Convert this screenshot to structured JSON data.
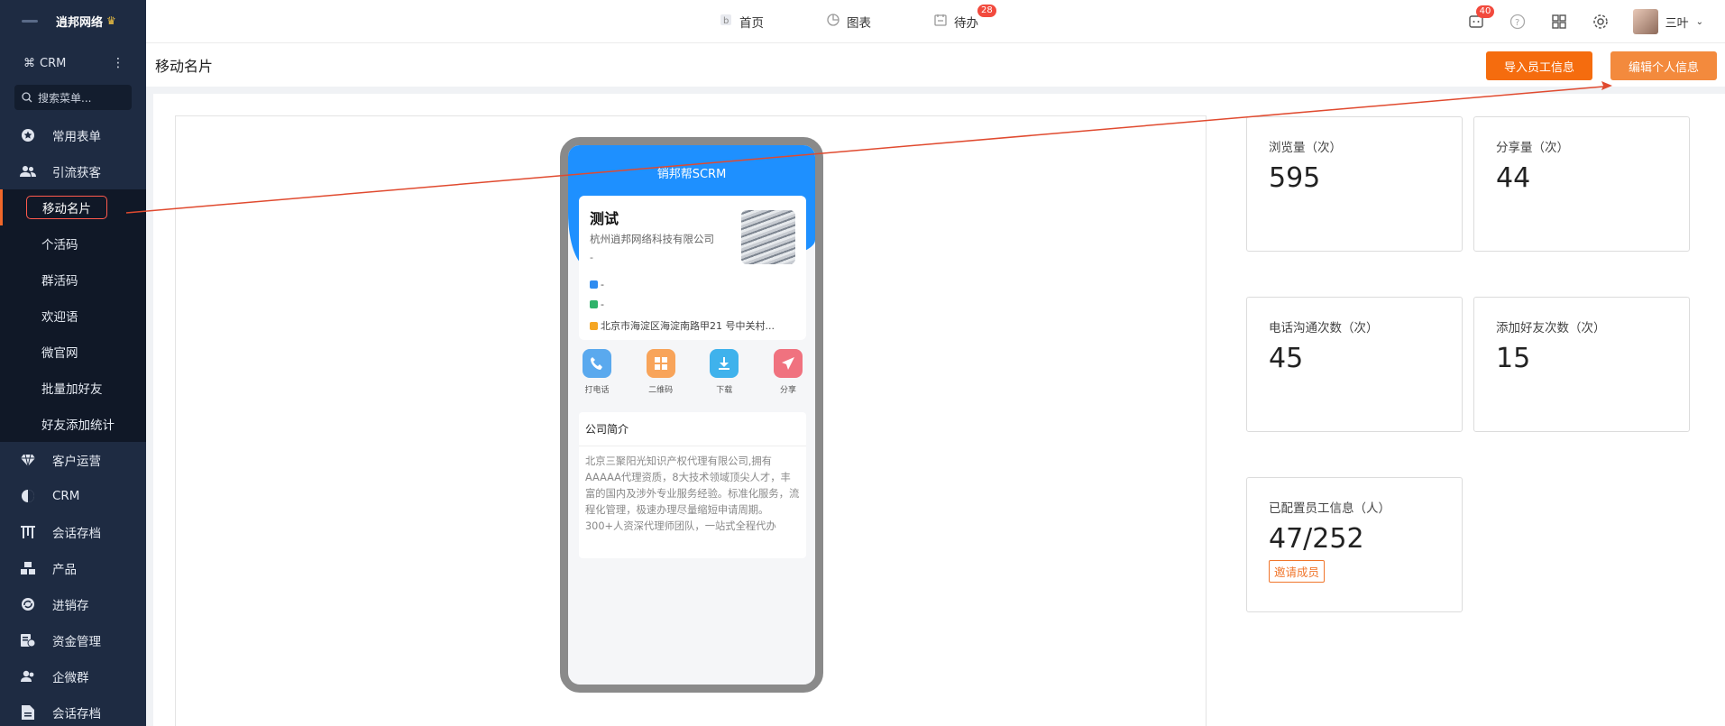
{
  "sidebar": {
    "logo": "逍邦网络",
    "crm_label": "CRM",
    "search_placeholder": "搜索菜单...",
    "menu": [
      {
        "label": "常用表单",
        "icon": "star-icon"
      },
      {
        "label": "引流获客",
        "icon": "users-icon"
      }
    ],
    "submenu": [
      {
        "label": "移动名片",
        "active": true
      },
      {
        "label": "个活码"
      },
      {
        "label": "群活码"
      },
      {
        "label": "欢迎语"
      },
      {
        "label": "微官网"
      },
      {
        "label": "批量加好友"
      },
      {
        "label": "好友添加统计"
      }
    ],
    "menu2": [
      {
        "label": "客户运营",
        "icon": "diamond-icon"
      },
      {
        "label": "CRM",
        "icon": "pie-icon"
      },
      {
        "label": "会话存档",
        "icon": "archive-icon"
      },
      {
        "label": "产品",
        "icon": "boxes-icon"
      },
      {
        "label": "进销存",
        "icon": "cycle-icon"
      },
      {
        "label": "资金管理",
        "icon": "finance-icon"
      },
      {
        "label": "企微群",
        "icon": "group-icon"
      },
      {
        "label": "会话存档",
        "icon": "doc-icon"
      }
    ]
  },
  "topbar": {
    "tabs": [
      {
        "label": "首页",
        "icon": "home-icon"
      },
      {
        "label": "图表",
        "icon": "chart-icon"
      },
      {
        "label": "待办",
        "icon": "todo-icon",
        "badge": "28"
      }
    ],
    "message_badge": "40",
    "user_name": "三叶"
  },
  "page": {
    "title": "移动名片",
    "import_button": "导入员工信息",
    "edit_button": "编辑个人信息"
  },
  "phone": {
    "header": "销邦帮SCRM",
    "name": "测试",
    "company": "杭州逍邦网络科技有限公司",
    "dash": "-",
    "line1": "-",
    "line2": "-",
    "address": "北京市海淀区海淀南路甲21 号中关村...",
    "actions": [
      {
        "label": "打电话",
        "icon": "phone-icon",
        "color": "#5aa9ee"
      },
      {
        "label": "二维码",
        "icon": "qrcode-icon",
        "color": "#f8a45a"
      },
      {
        "label": "下载",
        "icon": "download-icon",
        "color": "#3fb2ec"
      },
      {
        "label": "分享",
        "icon": "share-icon",
        "color": "#f0727f"
      }
    ],
    "intro_title": "公司简介",
    "intro_text": "北京三聚阳光知识产权代理有限公司,拥有AAAAA代理资质，8大技术领域顶尖人才，丰富的国内及涉外专业服务经验。标准化服务，流程化管理，极速办理尽量缩短申请周期。300+人资深代理师团队，一站式全程代办"
  },
  "stats": [
    {
      "label": "浏览量（次）",
      "value": "595"
    },
    {
      "label": "分享量（次）",
      "value": "44"
    },
    {
      "label": "电话沟通次数（次）",
      "value": "45"
    },
    {
      "label": "添加好友次数（次）",
      "value": "15"
    },
    {
      "label": "已配置员工信息（人）",
      "value": "47/252",
      "action": "邀请成员"
    }
  ],
  "colors": {
    "sidebar": "#1e2b42",
    "accent": "#f56c0e",
    "phone_header": "#1e90ff",
    "annotation": "#e04a2f"
  }
}
